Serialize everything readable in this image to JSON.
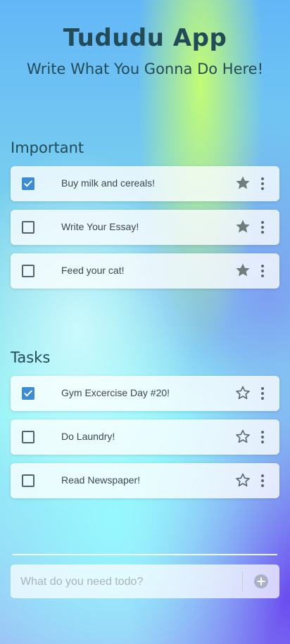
{
  "header": {
    "title": "Tududu App",
    "subtitle": "Write What You Gonna Do Here!"
  },
  "sections": [
    {
      "title": "Important",
      "items": [
        {
          "label": "Buy milk and cereals!",
          "checked": true,
          "starred": true
        },
        {
          "label": "Write Your Essay!",
          "checked": false,
          "starred": true
        },
        {
          "label": "Feed your cat!",
          "checked": false,
          "starred": true
        }
      ]
    },
    {
      "title": "Tasks",
      "items": [
        {
          "label": "Gym Excercise Day #20!",
          "checked": true,
          "starred": false
        },
        {
          "label": "Do Laundry!",
          "checked": false,
          "starred": false
        },
        {
          "label": "Read Newspaper!",
          "checked": false,
          "starred": false
        }
      ]
    }
  ],
  "new_task": {
    "placeholder": "What do you need todo?",
    "value": ""
  },
  "icons": {
    "checkbox": "checkbox-icon",
    "star_filled": "star-filled-icon",
    "star_outline": "star-outline-icon",
    "more": "more-vertical-icon",
    "add": "plus-circle-icon"
  },
  "colors": {
    "accent": "#3b8bd6",
    "text_dark": "#234a57",
    "star_filled": "#6f7d7c"
  }
}
